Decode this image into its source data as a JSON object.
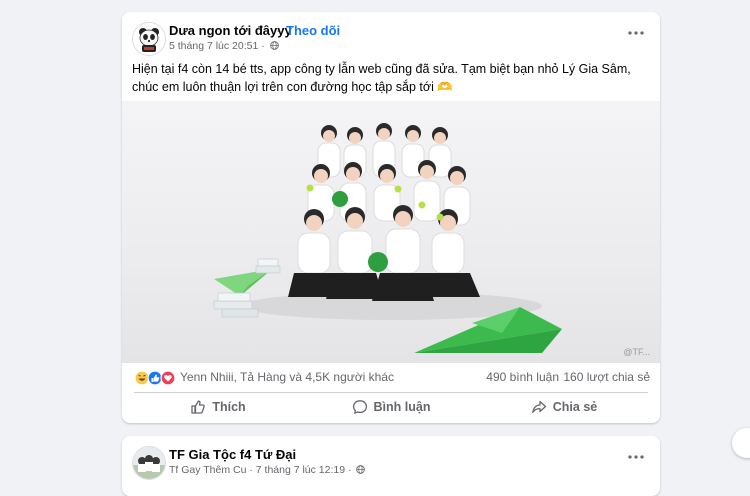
{
  "post1": {
    "author": "Dưa ngon tới đâyyy",
    "separator": "·",
    "follow_label": "Theo dõi",
    "timestamp": "5 tháng 7 lúc 20:51",
    "meta_sep": "·",
    "privacy_icon": "globe-icon",
    "caption": "Hiện tại f4 còn 14 bé tts, app công ty lẫn web cũng đã sửa. Tạm biệt bạn nhỏ Lý Gia Sâm, chúc em luôn thuận lợi trên con đường học tập sắp tới 🫶",
    "watermark": "@TF...",
    "reaction_icons": [
      "haha-icon",
      "like-icon",
      "love-icon"
    ],
    "reaction_summary": "Yenn Nhiii, Tả Hàng và 4,5K người khác",
    "comments": "490 bình luận",
    "shares": "160 lượt chia sẻ",
    "actions": {
      "like": "Thích",
      "comment": "Bình luận",
      "share": "Chia sẻ"
    }
  },
  "post2": {
    "author": "TF Gia Tộc f4 Tứ Đại",
    "sub_author": "Tf Gay Thêm Cu",
    "timestamp": "7 tháng 7 lúc 12:19",
    "meta_sep": "·",
    "privacy_icon": "globe-icon"
  },
  "colors": {
    "accent": "#1877f2",
    "background": "#f0f2f5",
    "secondary_text": "#65676b"
  }
}
